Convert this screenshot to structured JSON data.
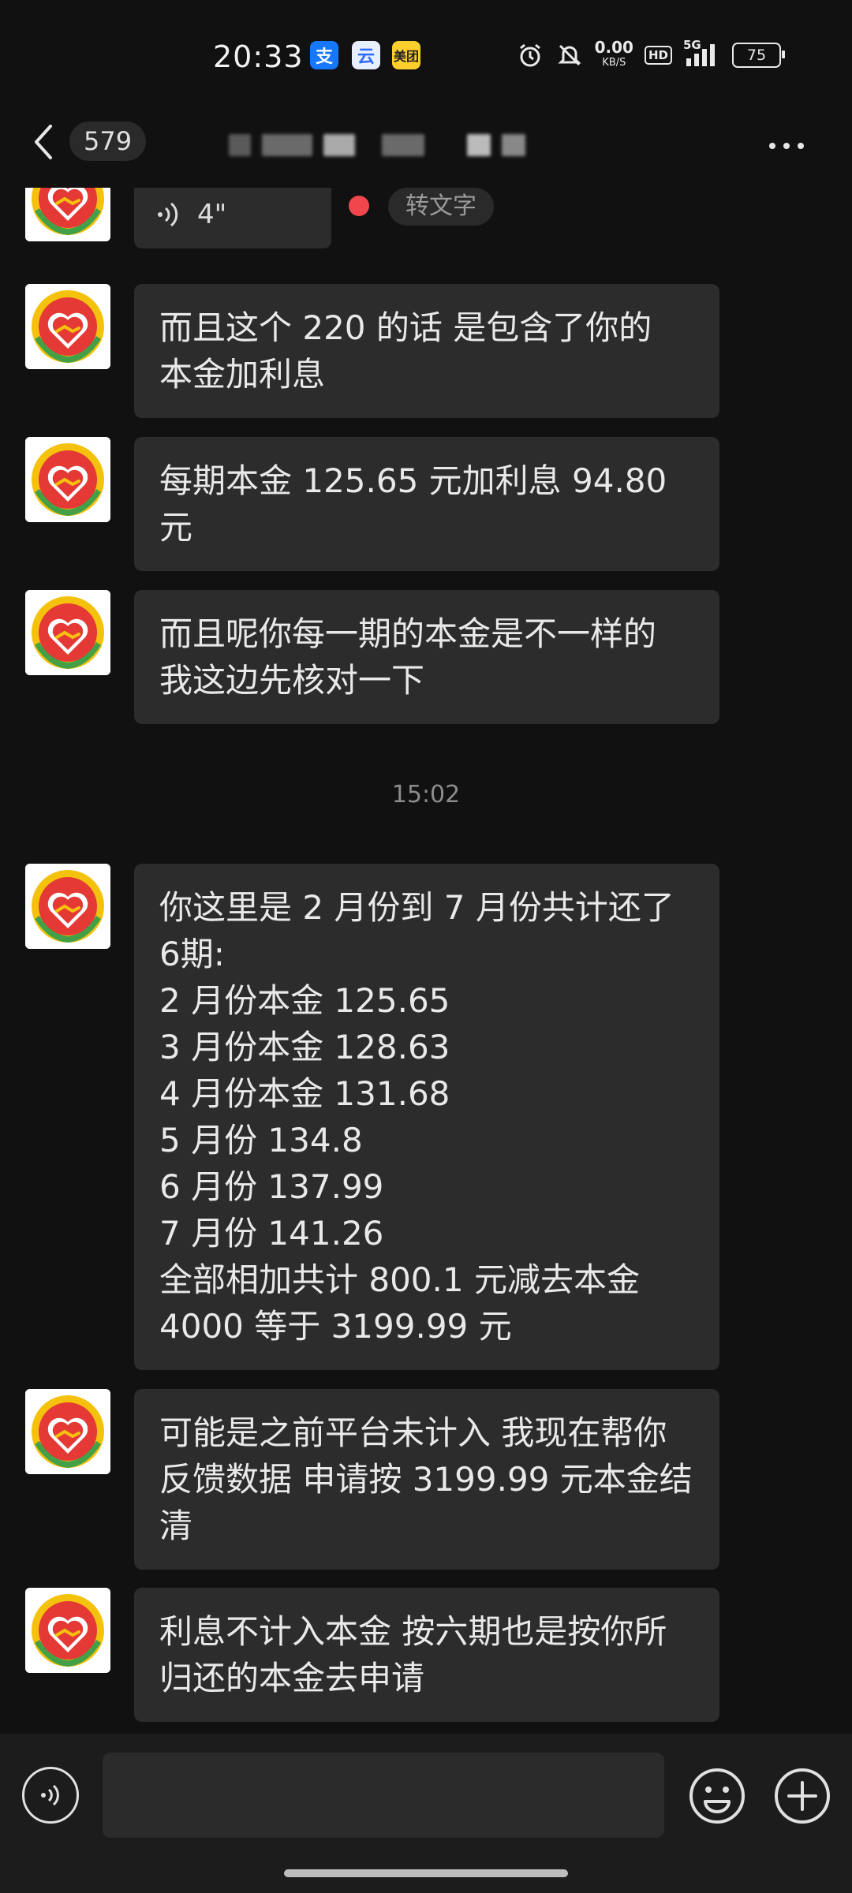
{
  "status_bar": {
    "time": "20:33",
    "app_icons": [
      "支",
      "云",
      "美团"
    ],
    "net_speed_value": "0.00",
    "net_speed_unit": "KB/S",
    "hd_label": "HD",
    "signal_label": "5G",
    "battery_level": "75"
  },
  "header": {
    "unread_count": "579"
  },
  "voice_message": {
    "duration": "4\"",
    "to_text_label": "转文字"
  },
  "messages": [
    "而且这个 220 的话 是包含了你的\n本金加利息",
    "每期本金 125.65 元加利息 94.80\n元",
    "而且呢你每一期的本金是不一样的\n我这边先核对一下",
    "你这里是 2 月份到 7 月份共计还了\n6期:\n2 月份本金 125.65\n3 月份本金 128.63\n4 月份本金 131.68\n5 月份 134.8\n6 月份 137.99\n7 月份 141.26\n全部相加共计 800.1 元减去本金\n4000 等于 3199.99 元",
    "可能是之前平台未计入 我现在帮你\n反馈数据 申请按 3199.99 元本金结\n清",
    "利息不计入本金 按六期也是按你所\n归还的本金去申请"
  ],
  "timestamp": "15:02",
  "input": {
    "value": "",
    "placeholder": ""
  },
  "colors": {
    "background": "#111111",
    "bubble": "#2c2c2c",
    "unread_dot": "#f0464c",
    "avatar_red": "#e53935",
    "avatar_gold": "#f4c20d",
    "avatar_green": "#43a047"
  }
}
